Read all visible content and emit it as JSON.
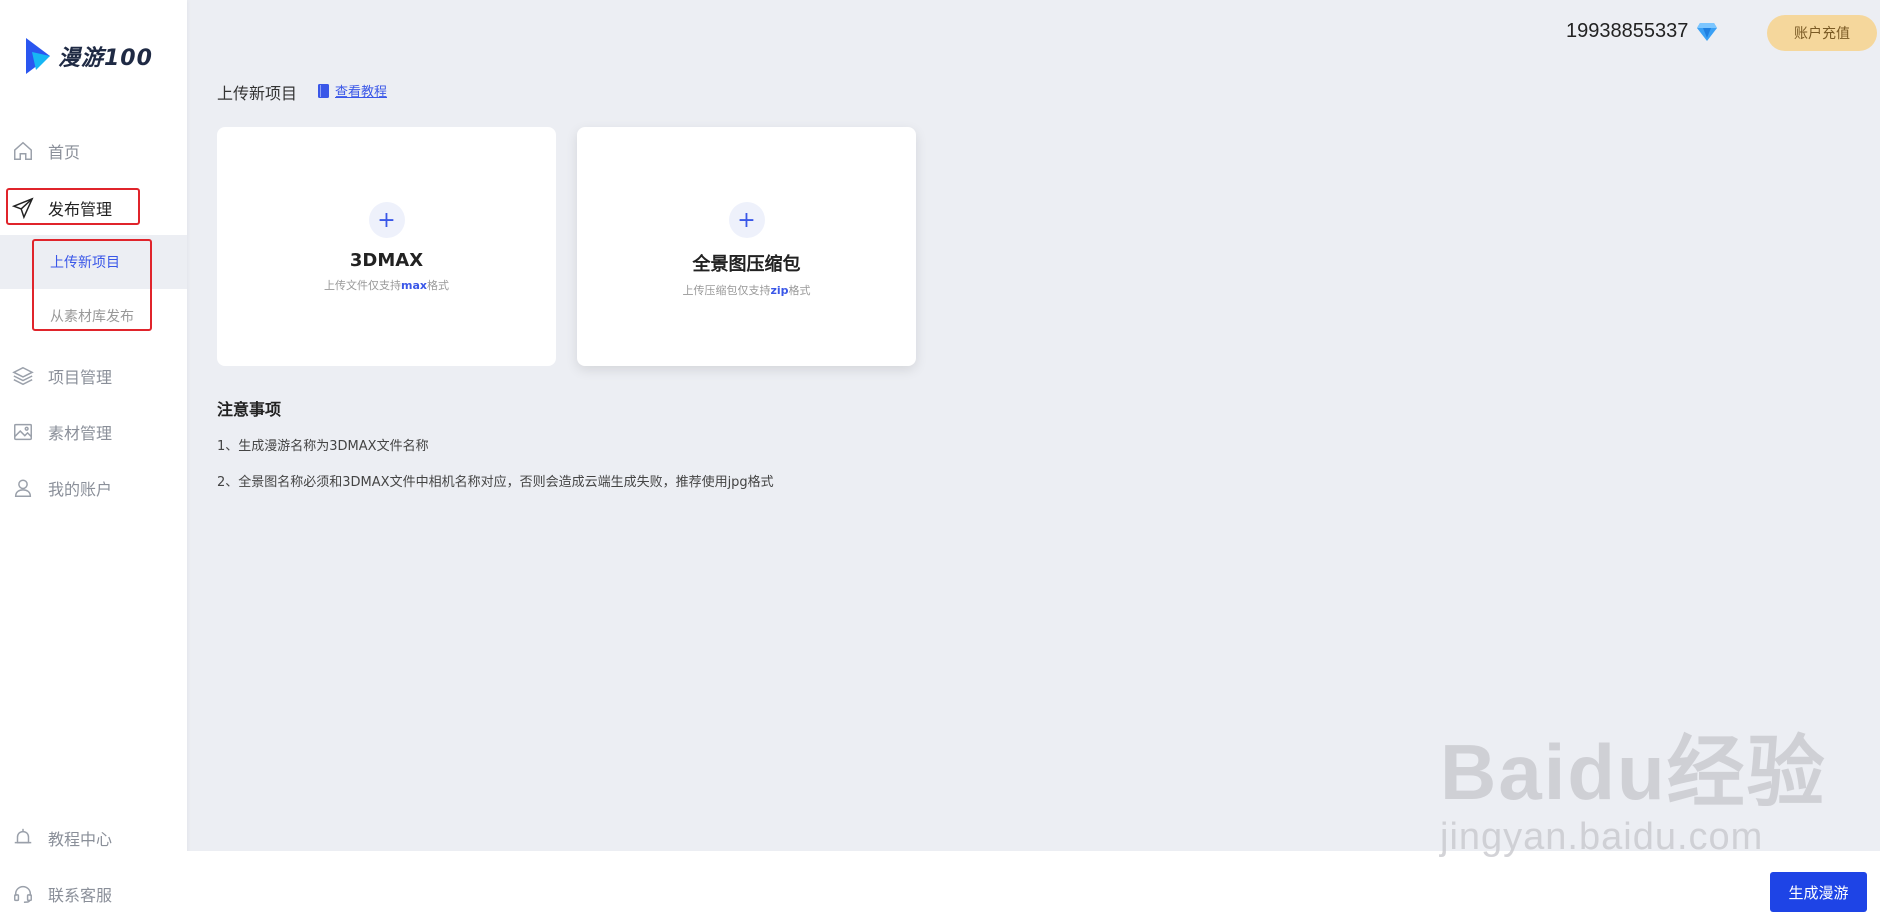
{
  "app": {
    "logo_text": "漫游100"
  },
  "sidebar": {
    "items": [
      {
        "label": "首页",
        "icon": "home-icon"
      },
      {
        "label": "发布管理",
        "icon": "paper-plane-icon"
      },
      {
        "label": "项目管理",
        "icon": "layers-icon"
      },
      {
        "label": "素材管理",
        "icon": "image-icon"
      },
      {
        "label": "我的账户",
        "icon": "user-icon"
      }
    ],
    "sub_items": [
      {
        "label": "上传新项目"
      },
      {
        "label": "从素材库发布"
      }
    ],
    "bottom_items": [
      {
        "label": "教程中心",
        "icon": "bell-icon"
      },
      {
        "label": "联系客服",
        "icon": "headset-icon"
      }
    ]
  },
  "header": {
    "account_number": "19938855337",
    "recharge_label": "账户充值"
  },
  "main": {
    "section_title": "上传新项目",
    "tutorial_link": "查看教程",
    "cards": [
      {
        "title": "3DMAX",
        "desc_prefix": "上传文件仅支持",
        "desc_format": "max",
        "desc_suffix": "格式"
      },
      {
        "title": "全景图压缩包",
        "desc_prefix": "上传压缩包仅支持",
        "desc_format": "zip",
        "desc_suffix": "格式"
      }
    ],
    "notes_title": "注意事项",
    "notes": [
      "1、生成漫游名称为3DMAX文件名称",
      "2、全景图名称必须和3DMAX文件中相机名称对应，否则会造成云端生成失败，推荐使用jpg格式"
    ]
  },
  "footer": {
    "generate_label": "生成漫游"
  },
  "watermark": {
    "main": "Baidu经验",
    "sub": "jingyan.baidu.com"
  },
  "colors": {
    "accent": "#3a57e8",
    "highlight": "#e0242b",
    "recharge": "#f5d79c"
  }
}
